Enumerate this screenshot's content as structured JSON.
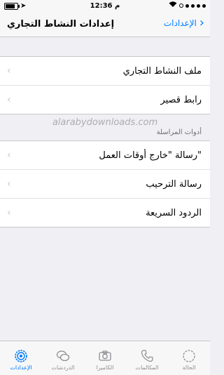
{
  "status_bar": {
    "time": "12:36 م"
  },
  "nav": {
    "title": "إعدادات النشاط التجاري",
    "back_label": "الإعدادات"
  },
  "group1": [
    {
      "label": "ملف النشاط التجاري"
    },
    {
      "label": "رابط قصير"
    }
  ],
  "section_header": "أدوات المراسلة",
  "watermark": "alarabydownloads.com",
  "group2": [
    {
      "label": "رسالة \"خارج أوقات العمل\""
    },
    {
      "label": "رسالة الترحيب"
    },
    {
      "label": "الردود السريعة"
    }
  ],
  "tabs": [
    {
      "label": "الإعدادات",
      "icon": "gear-icon",
      "active": true
    },
    {
      "label": "الدردشات",
      "icon": "chat-bubbles-icon",
      "active": false
    },
    {
      "label": "الكاميرا",
      "icon": "camera-icon",
      "active": false
    },
    {
      "label": "المكالمات",
      "icon": "phone-icon",
      "active": false
    },
    {
      "label": "الحالة",
      "icon": "status-icon",
      "active": false
    }
  ],
  "colors": {
    "accent": "#007aff",
    "background": "#efeff4"
  }
}
